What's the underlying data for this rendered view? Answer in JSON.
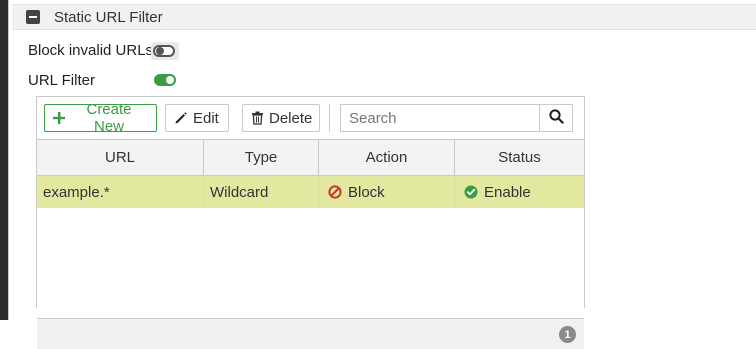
{
  "section": {
    "title": "Static URL Filter"
  },
  "settings": {
    "block_invalid_urls": {
      "label": "Block invalid URLs",
      "state": "off"
    },
    "url_filter": {
      "label": "URL Filter",
      "state": "on"
    }
  },
  "toolbar": {
    "create_label": "Create New",
    "edit_label": "Edit",
    "delete_label": "Delete",
    "search_placeholder": "Search"
  },
  "table": {
    "columns": [
      "URL",
      "Type",
      "Action",
      "Status"
    ],
    "rows": [
      {
        "url": "example.*",
        "type": "Wildcard",
        "action": "Block",
        "status": "Enable"
      }
    ],
    "row_count": "1"
  },
  "colors": {
    "accent_green": "#3a9d44",
    "selected_row": "#e3e8a1",
    "block_red": "#d32f2f"
  }
}
